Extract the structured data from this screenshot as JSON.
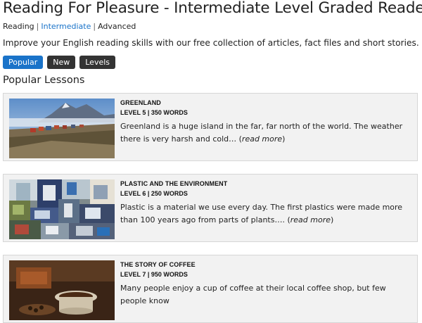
{
  "page": {
    "title": "Reading For Pleasure - Intermediate Level Graded Readers",
    "intro": "Improve your English reading skills with our free collection of articles, fact files and short stories."
  },
  "breadcrumb": {
    "items": [
      "Reading",
      "Intermediate",
      "Advanced"
    ],
    "separator": "|"
  },
  "buttons": {
    "popular": "Popular",
    "new": "New",
    "levels": "Levels"
  },
  "section": {
    "title": "Popular Lessons"
  },
  "lessons": [
    {
      "title": "GREENLAND",
      "level": "LEVEL 5 | 350 WORDS",
      "excerpt": "Greenland is a huge island in the far, far north of the world. The weather there is very harsh and cold… (",
      "more": "read more",
      "close": ")"
    },
    {
      "title": "PLASTIC AND THE ENVIRONMENT",
      "level": "LEVEL 6 | 250 WORDS",
      "excerpt": "Plastic is a material we use every day. The first plastics were made more than 100 years ago from parts of plants…. (",
      "more": "read more",
      "close": ")"
    },
    {
      "title": "THE STORY OF COFFEE",
      "level": "LEVEL 7 | 950 WORDS",
      "excerpt": "Many people enjoy a cup of coffee at their local coffee shop, but few people know",
      "more": "",
      "close": ""
    }
  ],
  "colors": {
    "accent": "#1a73c9",
    "dark_button": "#333333",
    "card_bg": "#f2f2f2"
  }
}
